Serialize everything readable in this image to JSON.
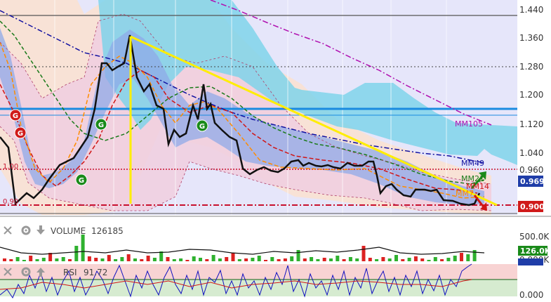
{
  "colors": {
    "panel_bg": "#e6e6fa",
    "bollinger_fill": "#f1d6e3",
    "cloud": "#7fd3ea",
    "ribbon": "#8fa9e8",
    "price": "#111111",
    "trend": "#ffee00",
    "up": "#2fb12f",
    "down": "#dd2222",
    "mm105": "#b010b0",
    "mm49": "#1010a0",
    "mm21": "#1a7a1a",
    "mm14": "#d01515",
    "mm7": "#ff8c00",
    "hline_blue": "#1a8be0"
  },
  "price_axis": {
    "ticks": [
      "1.440",
      "1.360",
      "1.280",
      "1.200",
      "1.120",
      "1.040",
      "0.960"
    ],
    "last_price_tag": "0.969",
    "level_tag": "0.900"
  },
  "chart_labels": {
    "level_1": "1.00",
    "level_2": "0.90",
    "mm105": "MM105",
    "mm49": "MM49",
    "mm21": "MM21",
    "mm14": "MM14",
    "mm7": "MM7"
  },
  "signals": [
    {
      "kind": "sell",
      "text": "G"
    },
    {
      "kind": "sell",
      "text": "G"
    },
    {
      "kind": "buy",
      "text": "G"
    },
    {
      "kind": "buy",
      "text": "G"
    },
    {
      "kind": "buy",
      "text": "G"
    }
  ],
  "volume_panel": {
    "title": "VOLUME",
    "value": "126185",
    "axis": [
      "500.0K",
      "0.000K"
    ],
    "tag": "126.0K"
  },
  "rsi_panel": {
    "title": "RSI",
    "value": "91.72",
    "axis": [
      "0.000"
    ],
    "tag": "91.72"
  },
  "icons": {
    "close": "close-icon",
    "settings": "gear-icon",
    "move": "arrow-down-icon"
  },
  "chart_data": {
    "type": "line",
    "ylim": [
      0.88,
      1.455
    ],
    "x": [
      0,
      2,
      4,
      6,
      8,
      10,
      12,
      14,
      16,
      18,
      20,
      22,
      24,
      26,
      28,
      30,
      32,
      34,
      36,
      38,
      40,
      42,
      44,
      46,
      48,
      50,
      52,
      54,
      56,
      58,
      60,
      62,
      64,
      66,
      68,
      70,
      72,
      74,
      76,
      78,
      80,
      82,
      84,
      86,
      88,
      90,
      92,
      94,
      96,
      98,
      100
    ],
    "series": [
      {
        "name": "price",
        "values": [
          1.05,
          0.9,
          0.92,
          0.92,
          0.97,
          0.98,
          1.03,
          1.06,
          1.27,
          1.27,
          1.36,
          1.22,
          1.18,
          1.07,
          1.1,
          1.2,
          1.12,
          1.19,
          1.08,
          1.05,
          0.97,
          0.98,
          0.98,
          0.97,
          1.0,
          1.0,
          0.99,
          0.98,
          0.99,
          0.98,
          0.98,
          0.99,
          0.99,
          0.98,
          0.98,
          0.99,
          1.0,
          0.99,
          0.99,
          0.93,
          0.94,
          0.93,
          0.93,
          0.95,
          0.95,
          0.92,
          0.91,
          0.91,
          0.91,
          0.95,
          0.97
        ]
      },
      {
        "name": "MM105",
        "values": [
          null,
          null,
          null,
          null,
          null,
          null,
          null,
          null,
          null,
          null,
          null,
          null,
          null,
          null,
          null,
          null,
          null,
          null,
          1.46,
          1.43,
          1.41,
          1.39,
          1.37,
          1.35,
          1.33,
          1.31,
          1.29,
          1.27,
          1.25,
          1.23,
          1.21,
          1.19,
          1.17,
          1.15,
          1.13,
          1.12,
          1.11,
          1.1,
          1.09,
          1.08,
          null,
          null,
          null,
          null,
          null,
          null,
          null,
          null,
          null,
          null,
          null
        ]
      },
      {
        "name": "MM49",
        "values": [
          1.4,
          1.35,
          1.3,
          1.26,
          1.23,
          1.21,
          1.2,
          1.2,
          1.2,
          1.2,
          1.2,
          1.2,
          1.19,
          1.18,
          1.16,
          1.15,
          1.14,
          1.13,
          1.12,
          1.11,
          1.1,
          1.09,
          1.08,
          1.07,
          1.06,
          1.05,
          1.04,
          1.03,
          1.02,
          1.01,
          1.0,
          0.99,
          0.98,
          0.97,
          0.97,
          0.97,
          0.97,
          0.97,
          0.97,
          0.97,
          0.97,
          0.97,
          0.97,
          0.97,
          0.97,
          0.97,
          0.97,
          0.97,
          0.97,
          0.97,
          0.97
        ]
      },
      {
        "name": "MM21",
        "values": [
          1.35,
          1.22,
          1.12,
          1.05,
          1.01,
          0.99,
          0.99,
          1.01,
          1.05,
          1.1,
          1.16,
          1.2,
          1.2,
          1.19,
          1.17,
          1.16,
          1.14,
          1.13,
          1.11,
          1.09,
          1.07,
          1.05,
          1.03,
          1.01,
          1.0,
          0.99,
          0.99,
          0.99,
          0.99,
          0.99,
          0.99,
          0.99,
          0.99,
          0.99,
          0.98,
          0.97,
          0.96,
          0.95,
          0.95,
          0.95,
          0.95,
          0.95,
          0.95,
          0.95,
          0.95,
          0.95,
          0.95,
          0.95,
          0.95,
          0.95,
          0.96
        ]
      }
    ]
  }
}
